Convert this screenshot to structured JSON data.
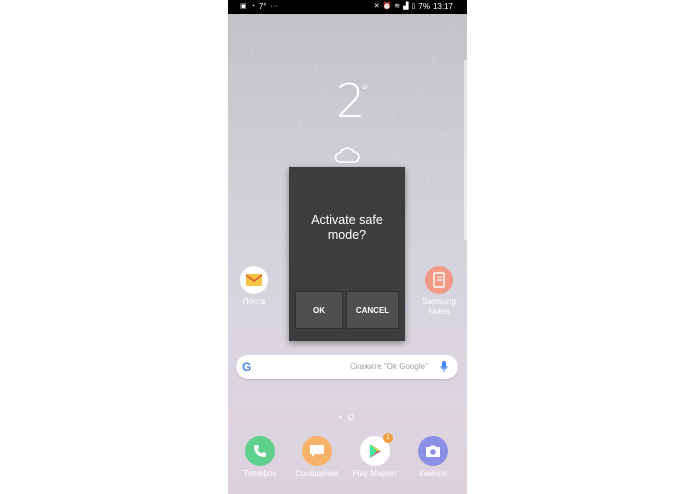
{
  "status_bar": {
    "left_text": "7°",
    "battery": "7%",
    "time": "13:17"
  },
  "weather": {
    "temperature": "2",
    "degree_symbol": "°"
  },
  "apps_row": [
    {
      "label": "Почта"
    },
    {
      "label": "Samsung Notes"
    }
  ],
  "search": {
    "placeholder": "Скажите \"Ok Google\""
  },
  "dock": [
    {
      "label": "Телефон"
    },
    {
      "label": "Сообщения"
    },
    {
      "label": "Play Маркет",
      "badge": "1"
    },
    {
      "label": "Камера"
    }
  ],
  "dialog": {
    "message": "Activate safe mode?",
    "ok_label": "OK",
    "cancel_label": "CANCEL"
  }
}
